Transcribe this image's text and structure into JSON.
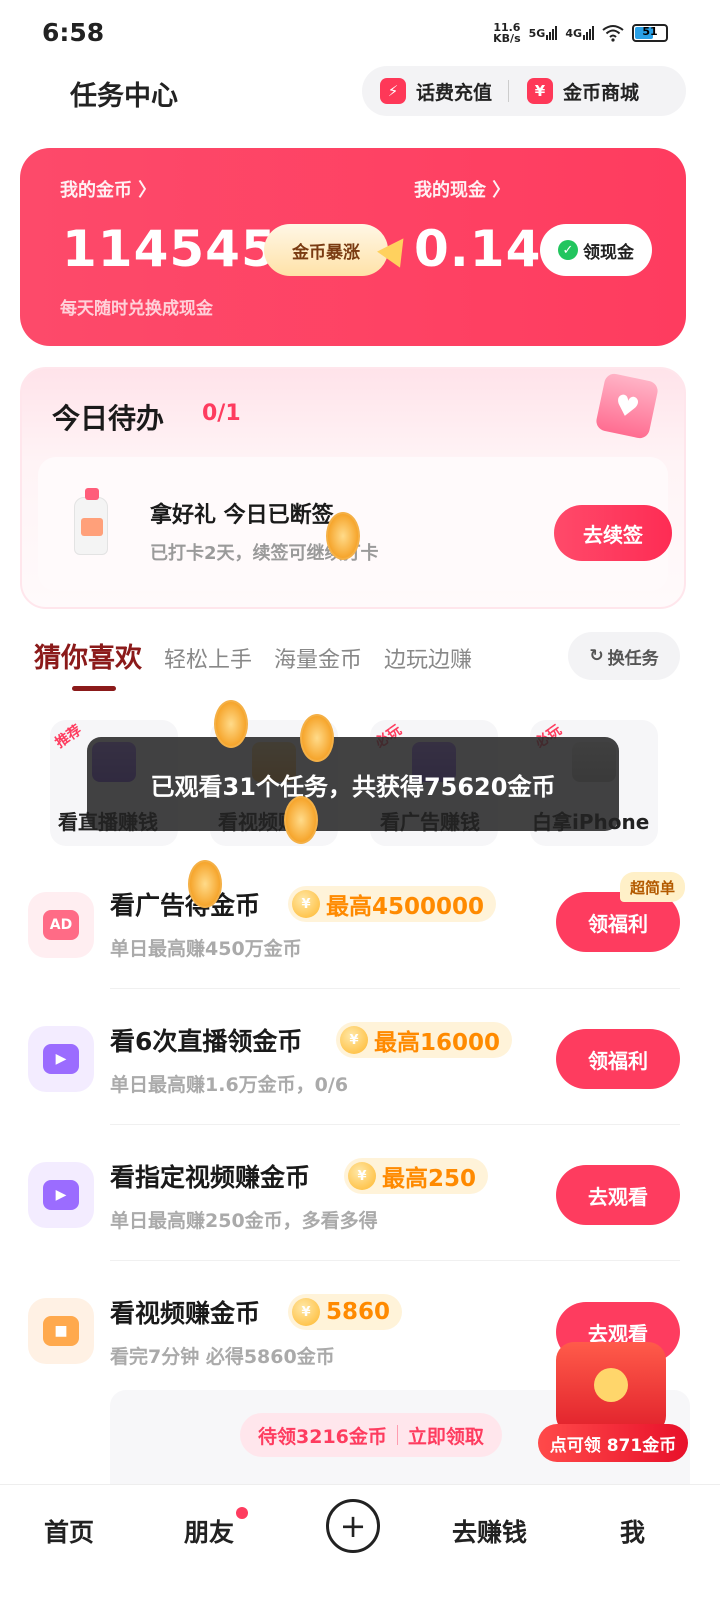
{
  "status_bar": {
    "time": "6:58",
    "net_speed_value": "11.6",
    "net_speed_unit": "KB/s",
    "sig1": "5G",
    "sig2": "4G",
    "battery": "51"
  },
  "header": {
    "title": "任务中心",
    "recharge_label": "话费充值",
    "mall_label": "金币商城"
  },
  "coin_card": {
    "coins_label": "我的金币 〉",
    "coins_value": "114545",
    "surge_label": "金币暴涨",
    "cash_label": "我的现金 〉",
    "cash_value": "0.14",
    "withdraw_label": "领现金",
    "subtitle": "每天随时兑换成现金"
  },
  "todo": {
    "title": "今日待办",
    "count": "0/1",
    "item_title": "拿好礼 今日已断签",
    "item_desc": "已打卡2天，续签可继续打卡",
    "button": "去续签"
  },
  "tabs": [
    "猜你喜欢",
    "轻松上手",
    "海量金币",
    "边玩边赚"
  ],
  "swap_label": "换任务",
  "tiles": [
    {
      "tag": "推荐",
      "label": "看直播赚钱"
    },
    {
      "tag": "",
      "label": "看视频赚钱"
    },
    {
      "tag": "必玩",
      "label": "看广告赚钱"
    },
    {
      "tag": "必玩",
      "label": "白拿iPhone"
    }
  ],
  "toast": "已观看31个任务，共获得75620金币",
  "tasks": [
    {
      "title": "看广告得金币",
      "reward": "最高4500000",
      "desc": "单日最高赚450万金币",
      "button": "领福利",
      "icon_text": "AD",
      "badge": "超简单"
    },
    {
      "title": "看6次直播领金币",
      "reward": "最高16000",
      "desc": "单日最高赚1.6万金币，0/6",
      "button": "领福利"
    },
    {
      "title": "看指定视频赚金币",
      "reward": "最高250",
      "desc": "单日最高赚250金币，多看多得",
      "button": "去观看"
    },
    {
      "title": "看视频赚金币",
      "reward": "5860",
      "desc": "看完7分钟 必得5860金币",
      "button": "去观看"
    }
  ],
  "pending": {
    "left": "待领3216金币",
    "right": "立即领取"
  },
  "envelope_label": "点可领 871金币",
  "nav": {
    "home": "首页",
    "friends": "朋友",
    "earn": "去赚钱",
    "me": "我"
  },
  "colors": {
    "brand": "#fe3c5f",
    "reward_text": "#ff8a00",
    "tab_active": "#8b1a1a"
  }
}
